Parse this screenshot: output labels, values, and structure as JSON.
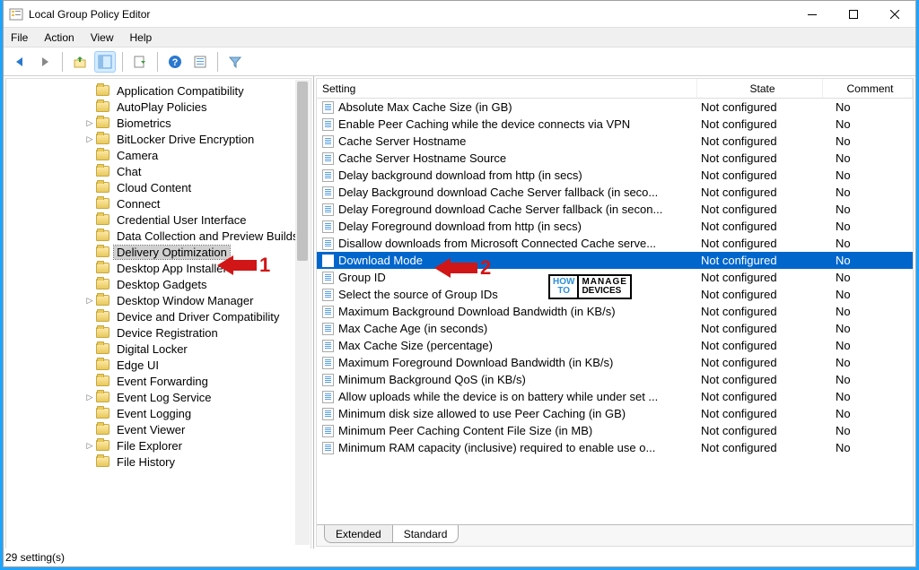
{
  "window": {
    "title": "Local Group Policy Editor"
  },
  "menubar": [
    "File",
    "Action",
    "View",
    "Help"
  ],
  "tree_items": [
    {
      "label": "Application Compatibility",
      "expander": ""
    },
    {
      "label": "AutoPlay Policies",
      "expander": ""
    },
    {
      "label": "Biometrics",
      "expander": "▷"
    },
    {
      "label": "BitLocker Drive Encryption",
      "expander": "▷"
    },
    {
      "label": "Camera",
      "expander": ""
    },
    {
      "label": "Chat",
      "expander": ""
    },
    {
      "label": "Cloud Content",
      "expander": ""
    },
    {
      "label": "Connect",
      "expander": ""
    },
    {
      "label": "Credential User Interface",
      "expander": ""
    },
    {
      "label": "Data Collection and Preview Builds",
      "expander": ""
    },
    {
      "label": "Delivery Optimization",
      "expander": "",
      "selected": true
    },
    {
      "label": "Desktop App Installer",
      "expander": ""
    },
    {
      "label": "Desktop Gadgets",
      "expander": ""
    },
    {
      "label": "Desktop Window Manager",
      "expander": "▷"
    },
    {
      "label": "Device and Driver Compatibility",
      "expander": ""
    },
    {
      "label": "Device Registration",
      "expander": ""
    },
    {
      "label": "Digital Locker",
      "expander": ""
    },
    {
      "label": "Edge UI",
      "expander": ""
    },
    {
      "label": "Event Forwarding",
      "expander": ""
    },
    {
      "label": "Event Log Service",
      "expander": "▷"
    },
    {
      "label": "Event Logging",
      "expander": ""
    },
    {
      "label": "Event Viewer",
      "expander": ""
    },
    {
      "label": "File Explorer",
      "expander": "▷"
    },
    {
      "label": "File History",
      "expander": ""
    }
  ],
  "columns": {
    "setting": "Setting",
    "state": "State",
    "comment": "Comment"
  },
  "rows": [
    {
      "name": "Absolute Max Cache Size (in GB)",
      "state": "Not configured",
      "comment": "No"
    },
    {
      "name": "Enable Peer Caching while the device connects via VPN",
      "state": "Not configured",
      "comment": "No"
    },
    {
      "name": "Cache Server Hostname",
      "state": "Not configured",
      "comment": "No"
    },
    {
      "name": "Cache Server Hostname Source",
      "state": "Not configured",
      "comment": "No"
    },
    {
      "name": "Delay background download from http (in secs)",
      "state": "Not configured",
      "comment": "No"
    },
    {
      "name": "Delay Background download Cache Server fallback (in seco...",
      "state": "Not configured",
      "comment": "No"
    },
    {
      "name": "Delay Foreground download Cache Server fallback (in secon...",
      "state": "Not configured",
      "comment": "No"
    },
    {
      "name": "Delay Foreground download from http (in secs)",
      "state": "Not configured",
      "comment": "No"
    },
    {
      "name": "Disallow downloads from Microsoft Connected Cache serve...",
      "state": "Not configured",
      "comment": "No"
    },
    {
      "name": "Download Mode",
      "state": "Not configured",
      "comment": "No",
      "selected": true
    },
    {
      "name": "Group ID",
      "state": "Not configured",
      "comment": "No"
    },
    {
      "name": "Select the source of Group IDs",
      "state": "Not configured",
      "comment": "No"
    },
    {
      "name": "Maximum Background Download Bandwidth (in KB/s)",
      "state": "Not configured",
      "comment": "No"
    },
    {
      "name": "Max Cache Age (in seconds)",
      "state": "Not configured",
      "comment": "No"
    },
    {
      "name": "Max Cache Size (percentage)",
      "state": "Not configured",
      "comment": "No"
    },
    {
      "name": "Maximum Foreground Download Bandwidth (in KB/s)",
      "state": "Not configured",
      "comment": "No"
    },
    {
      "name": "Minimum Background QoS (in KB/s)",
      "state": "Not configured",
      "comment": "No"
    },
    {
      "name": "Allow uploads while the device is on battery while under set ...",
      "state": "Not configured",
      "comment": "No"
    },
    {
      "name": "Minimum disk size allowed to use Peer Caching (in GB)",
      "state": "Not configured",
      "comment": "No"
    },
    {
      "name": "Minimum Peer Caching Content File Size (in MB)",
      "state": "Not configured",
      "comment": "No"
    },
    {
      "name": "Minimum RAM capacity (inclusive) required to enable use o...",
      "state": "Not configured",
      "comment": "No"
    }
  ],
  "tabs": {
    "extended": "Extended",
    "standard": "Standard"
  },
  "statusbar": "29 setting(s)",
  "annotations": {
    "num1": "1",
    "num2": "2"
  },
  "watermark": {
    "left_top": "HOW",
    "left_bot": "TO",
    "right_top": "MANAGE",
    "right_bot": "DEVICES"
  }
}
